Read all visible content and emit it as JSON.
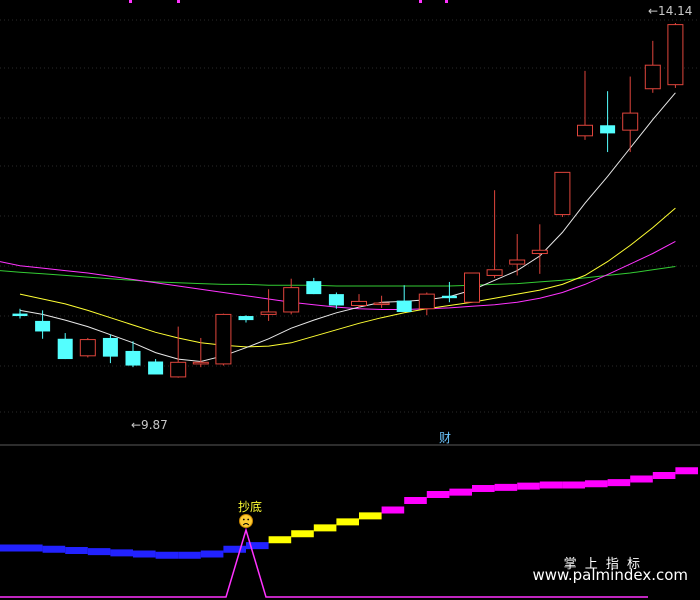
{
  "chart_data": [
    {
      "type": "candlestick",
      "title": "",
      "ylim": [
        9.2,
        14.3
      ],
      "xlabel": "",
      "ylabel": "",
      "grid": true,
      "annotations": {
        "high_label": "14.14",
        "low_label": "9.87"
      },
      "colors": {
        "up": "#e0453c",
        "down": "#54ffff",
        "ma5": "#e8e8e8",
        "ma10": "#ffff33",
        "ma20": "#ff33ff",
        "ma60": "#33cc33"
      },
      "candles": [
        {
          "o": 10.56,
          "h": 10.62,
          "l": 10.5,
          "c": 10.53
        },
        {
          "o": 10.47,
          "h": 10.6,
          "l": 10.25,
          "c": 10.34
        },
        {
          "o": 10.25,
          "h": 10.32,
          "l": 10.0,
          "c": 10.0
        },
        {
          "o": 10.04,
          "h": 10.26,
          "l": 10.02,
          "c": 10.24
        },
        {
          "o": 10.26,
          "h": 10.3,
          "l": 9.95,
          "c": 10.03
        },
        {
          "o": 10.1,
          "h": 10.22,
          "l": 9.9,
          "c": 9.92
        },
        {
          "o": 9.97,
          "h": 10.0,
          "l": 9.87,
          "c": 9.81
        },
        {
          "o": 9.78,
          "h": 10.4,
          "l": 9.77,
          "c": 9.96
        },
        {
          "o": 9.94,
          "h": 10.26,
          "l": 9.9,
          "c": 9.96
        },
        {
          "o": 9.94,
          "h": 10.56,
          "l": 9.92,
          "c": 10.55
        },
        {
          "o": 10.53,
          "h": 10.54,
          "l": 10.45,
          "c": 10.48
        },
        {
          "o": 10.55,
          "h": 10.86,
          "l": 10.47,
          "c": 10.58
        },
        {
          "o": 10.58,
          "h": 10.99,
          "l": 10.55,
          "c": 10.88
        },
        {
          "o": 10.96,
          "h": 11.0,
          "l": 10.8,
          "c": 10.8
        },
        {
          "o": 10.8,
          "h": 10.82,
          "l": 10.62,
          "c": 10.66
        },
        {
          "o": 10.66,
          "h": 10.8,
          "l": 10.63,
          "c": 10.71
        },
        {
          "o": 10.68,
          "h": 10.78,
          "l": 10.63,
          "c": 10.69
        },
        {
          "o": 10.72,
          "h": 10.91,
          "l": 10.6,
          "c": 10.58
        },
        {
          "o": 10.62,
          "h": 10.82,
          "l": 10.54,
          "c": 10.8
        },
        {
          "o": 10.78,
          "h": 10.95,
          "l": 10.7,
          "c": 10.75
        },
        {
          "o": 10.7,
          "h": 11.06,
          "l": 10.7,
          "c": 11.06
        },
        {
          "o": 11.03,
          "h": 12.08,
          "l": 11.0,
          "c": 11.1
        },
        {
          "o": 11.17,
          "h": 11.54,
          "l": 11.03,
          "c": 11.22
        },
        {
          "o": 11.3,
          "h": 11.66,
          "l": 11.05,
          "c": 11.34
        },
        {
          "o": 11.78,
          "h": 12.28,
          "l": 11.75,
          "c": 12.3
        },
        {
          "o": 12.75,
          "h": 13.55,
          "l": 12.7,
          "c": 12.88
        },
        {
          "o": 12.88,
          "h": 13.3,
          "l": 12.55,
          "c": 12.78
        },
        {
          "o": 12.82,
          "h": 13.48,
          "l": 12.55,
          "c": 13.03
        },
        {
          "o": 13.33,
          "h": 13.92,
          "l": 13.28,
          "c": 13.62
        },
        {
          "o": 13.38,
          "h": 14.14,
          "l": 13.34,
          "c": 14.12
        }
      ],
      "ma5": [
        10.6,
        10.55,
        10.48,
        10.4,
        10.3,
        10.2,
        10.08,
        10.0,
        9.97,
        10.04,
        10.14,
        10.25,
        10.38,
        10.48,
        10.57,
        10.64,
        10.7,
        10.71,
        10.73,
        10.77,
        10.85,
        10.97,
        11.09,
        11.27,
        11.56,
        11.92,
        12.25,
        12.6,
        12.95,
        13.28
      ],
      "ma10": [
        10.8,
        10.74,
        10.68,
        10.6,
        10.51,
        10.42,
        10.33,
        10.26,
        10.2,
        10.17,
        10.15,
        10.16,
        10.2,
        10.28,
        10.36,
        10.44,
        10.51,
        10.57,
        10.62,
        10.66,
        10.7,
        10.75,
        10.8,
        10.85,
        10.92,
        11.03,
        11.2,
        11.4,
        11.62,
        11.86
      ],
      "ma20": [
        11.15,
        11.12,
        11.09,
        11.06,
        11.02,
        10.98,
        10.94,
        10.9,
        10.86,
        10.82,
        10.78,
        10.74,
        10.7,
        10.67,
        10.64,
        10.62,
        10.61,
        10.61,
        10.62,
        10.63,
        10.65,
        10.67,
        10.7,
        10.75,
        10.82,
        10.92,
        11.04,
        11.17,
        11.3,
        11.45
      ],
      "ma60": [
        11.07,
        11.05,
        11.03,
        11.01,
        10.99,
        10.97,
        10.95,
        10.94,
        10.93,
        10.92,
        10.92,
        10.91,
        10.91,
        10.91,
        10.9,
        10.9,
        10.9,
        10.9,
        10.9,
        10.9,
        10.91,
        10.92,
        10.93,
        10.95,
        10.97,
        11.0,
        11.03,
        11.06,
        11.1,
        11.14
      ]
    },
    {
      "type": "indicator",
      "title": "",
      "ylim": [
        0,
        100
      ],
      "marker_label": "财",
      "signal_label": "抄底",
      "signal_icon": "sad-face-icon",
      "colors": {
        "low": "#2222ff",
        "mid": "#ffff00",
        "high": "#ff00ff"
      },
      "series": [
        {
          "values": [
            26,
            25,
            24,
            23,
            22,
            21,
            20,
            20,
            21,
            25,
            28,
            33,
            38,
            43,
            48,
            53,
            58,
            66,
            71,
            73,
            76,
            77,
            78,
            79,
            79,
            80,
            81,
            84,
            87,
            91
          ]
        }
      ],
      "signal_line": [
        0,
        0,
        0,
        0,
        0,
        0,
        0,
        0,
        0,
        0,
        100,
        0,
        0,
        0,
        0,
        0,
        0,
        0,
        0,
        0,
        0,
        0,
        0,
        0,
        0,
        0,
        0,
        0,
        0,
        0
      ]
    }
  ],
  "watermark": {
    "line1": "掌 上 指 标",
    "line2": "www.palmindex.com"
  }
}
